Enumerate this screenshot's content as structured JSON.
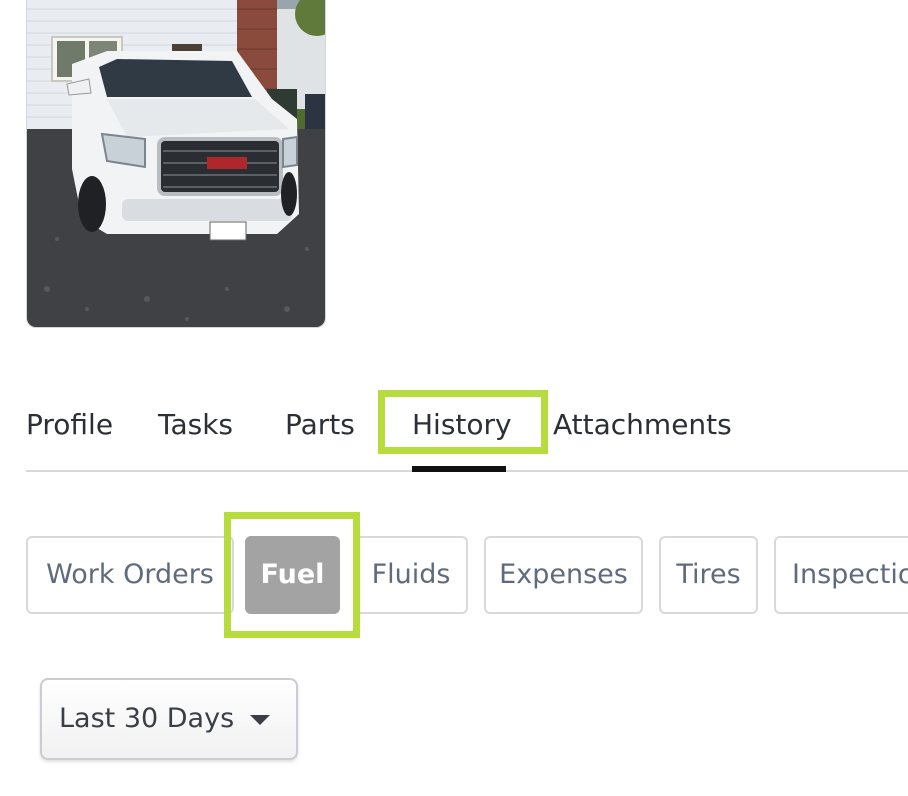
{
  "vehicle_photo": {
    "alt": "White GMC SUV parked in driveway"
  },
  "tabs": [
    {
      "label": "Profile",
      "active": false
    },
    {
      "label": "Tasks",
      "active": false
    },
    {
      "label": "Parts",
      "active": false
    },
    {
      "label": "History",
      "active": true
    },
    {
      "label": "Attachments",
      "active": false
    }
  ],
  "history_subtabs": [
    {
      "label": "Work Orders",
      "active": false
    },
    {
      "label": "Fuel",
      "active": true
    },
    {
      "label": "Fluids",
      "active": false
    },
    {
      "label": "Expenses",
      "active": false
    },
    {
      "label": "Tires",
      "active": false
    },
    {
      "label": "Inspectio",
      "active": false
    }
  ],
  "date_filter": {
    "selected": "Last 30 Days",
    "icon": "caret-down-icon"
  },
  "colors": {
    "highlight": "#b7dc3d",
    "active_chip_bg": "#a3a3a3",
    "active_tab_underline": "#111111"
  }
}
